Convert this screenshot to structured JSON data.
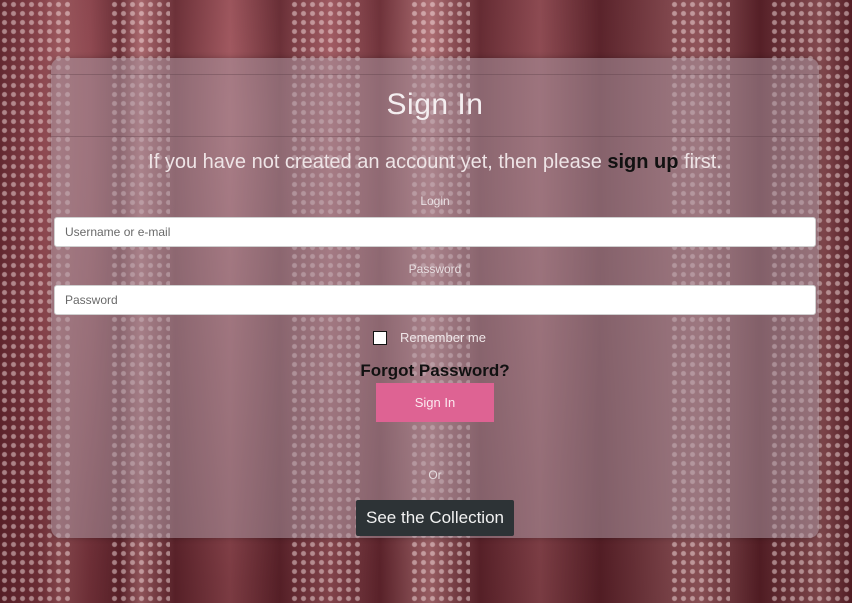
{
  "form": {
    "title": "Sign In",
    "signup_prefix": "If you have not created an account yet, then please ",
    "signup_link": "sign up",
    "signup_suffix": " first.",
    "login_label": "Login",
    "username_placeholder": "Username or e-mail",
    "password_label": "Password",
    "password_placeholder": "Password",
    "remember_label": "Remember me",
    "remember_checked": false,
    "forgot_link": "Forgot Password?",
    "signin_button": "Sign In",
    "or_text": "Or",
    "collection_button": "See the Collection"
  },
  "colors": {
    "signin_button_bg": "#de6393",
    "collection_button_bg": "#2d3336",
    "background": "#7a3a42"
  }
}
